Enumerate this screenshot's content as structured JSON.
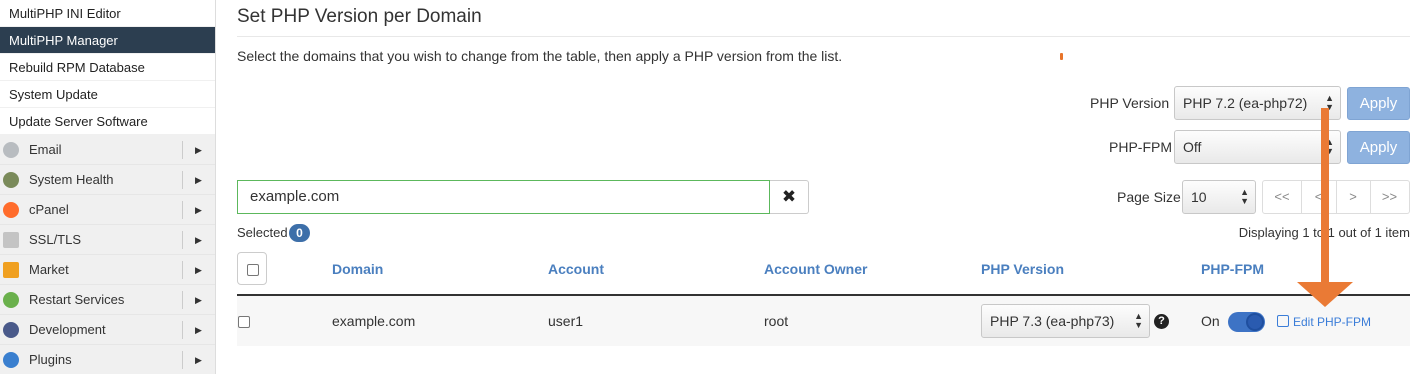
{
  "sidebar": {
    "sub_items": [
      {
        "label": "MultiPHP INI Editor",
        "active": false
      },
      {
        "label": "MultiPHP Manager",
        "active": true
      },
      {
        "label": "Rebuild RPM Database",
        "active": false
      },
      {
        "label": "System Update",
        "active": false
      },
      {
        "label": "Update Server Software",
        "active": false
      }
    ],
    "categories": [
      {
        "label": "Email",
        "icon": "email-icon",
        "color": "#9aa0a6"
      },
      {
        "label": "System Health",
        "icon": "gear-icon",
        "color": "#7a8a5a"
      },
      {
        "label": "cPanel",
        "icon": "cpanel-icon",
        "color": "#ff6c2c"
      },
      {
        "label": "SSL/TLS",
        "icon": "certificate-icon",
        "color": "#b0b0b0"
      },
      {
        "label": "Market",
        "icon": "cart-icon",
        "color": "#f0a020"
      },
      {
        "label": "Restart Services",
        "icon": "restart-icon",
        "color": "#6ab04c"
      },
      {
        "label": "Development",
        "icon": "wrench-icon",
        "color": "#4a5a8a"
      },
      {
        "label": "Plugins",
        "icon": "plugin-icon",
        "color": "#3a7fcf"
      }
    ]
  },
  "main": {
    "title": "Set PHP Version per Domain",
    "description": "Select the domains that you wish to change from the table, then apply a PHP version from the list.",
    "php_version_label": "PHP Version",
    "php_version_value": "PHP 7.2 (ea-php72)",
    "php_fpm_label": "PHP-FPM",
    "php_fpm_value": "Off",
    "apply_label": "Apply",
    "search_value": "example.com",
    "clear_glyph": "✖",
    "page_size_label": "Page Size",
    "page_size_value": "10",
    "pager": {
      "first": "<<",
      "prev": "<",
      "next": ">",
      "last": ">>"
    },
    "selected_label": "Selected",
    "selected_count": "0",
    "displaying": "Displaying 1 to 1 out of 1 item"
  },
  "table": {
    "headers": {
      "domain": "Domain",
      "account": "Account",
      "owner": "Account Owner",
      "php_version": "PHP Version",
      "php_fpm": "PHP-FPM"
    },
    "rows": [
      {
        "domain": "example.com",
        "account": "user1",
        "owner": "root",
        "php_version": "PHP 7.3 (ea-php73)",
        "php_fpm_state": "On",
        "edit_label": "Edit PHP-FPM"
      }
    ]
  },
  "colors": {
    "accent": "#4a7fbf",
    "apply_button": "#8eb2df",
    "annotation_arrow": "#ea7a35",
    "active_sidebar": "#2c3e50"
  }
}
